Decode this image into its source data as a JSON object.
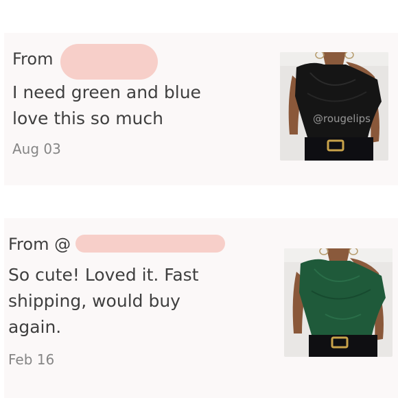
{
  "reviews": [
    {
      "from_label": "From",
      "message_lines": [
        "I need green and blue",
        "love this so much"
      ],
      "date": "Aug 03",
      "photo": {
        "top_color": "black",
        "watermark": "@rougelips"
      }
    },
    {
      "from_label": "From @",
      "message_lines": [
        "So cute! Loved it. Fast",
        "shipping, would buy",
        "again."
      ],
      "date": "Feb 16",
      "photo": {
        "top_color": "green"
      }
    }
  ],
  "colors": {
    "redaction": "#f7cfc9",
    "card_background": "#fbf8f8",
    "black_top": "#151515",
    "green_top": "#1f5a3a"
  }
}
